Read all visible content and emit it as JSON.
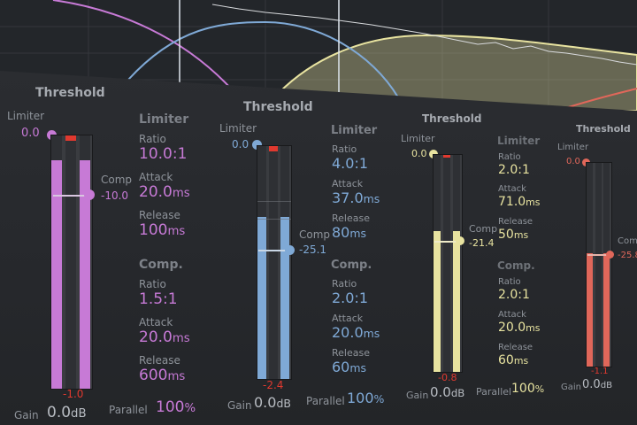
{
  "colors": {
    "purple": "#c77ad6",
    "blue": "#7fa9d6",
    "yellow": "#e8e3a0",
    "red": "#e0675a",
    "peak_red": "#e0392f"
  },
  "bands": [
    {
      "title": "Threshold",
      "limiter_label": "Limiter",
      "limiter_value": "0.0",
      "comp_label": "Comp",
      "comp_value": "-10.0",
      "limiter_section": "Limiter",
      "limiter_ratio_label": "Ratio",
      "limiter_ratio": "10.0:1",
      "limiter_attack_label": "Attack",
      "limiter_attack": "20.0",
      "limiter_attack_unit": "ms",
      "limiter_release_label": "Release",
      "limiter_release": "100",
      "limiter_release_unit": "ms",
      "comp_section": "Comp.",
      "comp_ratio_label": "Ratio",
      "comp_ratio": "1.5:1",
      "comp_attack_label": "Attack",
      "comp_attack": "20.0",
      "comp_attack_unit": "ms",
      "comp_release_label": "Release",
      "comp_release": "600",
      "comp_release_unit": "ms",
      "peak_value": "-1.0",
      "gain_label": "Gain",
      "gain_value": "0.0",
      "gain_unit": "dB",
      "parallel_label": "Parallel",
      "parallel_value": "100",
      "parallel_unit": "%",
      "meter_level": 1.0
    },
    {
      "title": "Threshold",
      "limiter_label": "Limiter",
      "limiter_value": "0.0",
      "comp_label": "Comp",
      "comp_value": "-25.1",
      "limiter_section": "Limiter",
      "limiter_ratio_label": "Ratio",
      "limiter_ratio": "4.0:1",
      "limiter_attack_label": "Attack",
      "limiter_attack": "37.0",
      "limiter_attack_unit": "ms",
      "limiter_release_label": "Release",
      "limiter_release": "80",
      "limiter_release_unit": "ms",
      "comp_section": "Comp.",
      "comp_ratio_label": "Ratio",
      "comp_ratio": "2.0:1",
      "comp_attack_label": "Attack",
      "comp_attack": "20.0",
      "comp_attack_unit": "ms",
      "comp_release_label": "Release",
      "comp_release": "60",
      "comp_release_unit": "ms",
      "peak_value": "-2.4",
      "gain_label": "Gain",
      "gain_value": "0.0",
      "gain_unit": "dB",
      "parallel_label": "Parallel",
      "parallel_value": "100",
      "parallel_unit": "%",
      "meter_level": 0.7
    },
    {
      "title": "Threshold",
      "limiter_label": "Limiter",
      "limiter_value": "0.0",
      "comp_label": "Comp",
      "comp_value": "-21.4",
      "limiter_section": "Limiter",
      "limiter_ratio_label": "Ratio",
      "limiter_ratio": "2.0:1",
      "limiter_attack_label": "Attack",
      "limiter_attack": "71.0",
      "limiter_attack_unit": "ms",
      "limiter_release_label": "Release",
      "limiter_release": "50",
      "limiter_release_unit": "ms",
      "comp_section": "Comp.",
      "comp_ratio_label": "Ratio",
      "comp_ratio": "2.0:1",
      "comp_attack_label": "Attack",
      "comp_attack": "20.0",
      "comp_attack_unit": "ms",
      "comp_release_label": "Release",
      "comp_release": "60",
      "comp_release_unit": "ms",
      "peak_value": "-0.8",
      "gain_label": "Gain",
      "gain_value": "0.0",
      "gain_unit": "dB",
      "parallel_label": "Parallel",
      "parallel_value": "100",
      "parallel_unit": "%",
      "meter_level": 0.65
    },
    {
      "title": "Threshold",
      "limiter_label": "Limiter",
      "limiter_value": "0.0",
      "comp_label": "Comp",
      "comp_value": "-25.8",
      "peak_value": "-1.1",
      "gain_label": "Gain",
      "gain_value": "0.0",
      "gain_unit": "dB",
      "meter_level": 0.55
    }
  ]
}
